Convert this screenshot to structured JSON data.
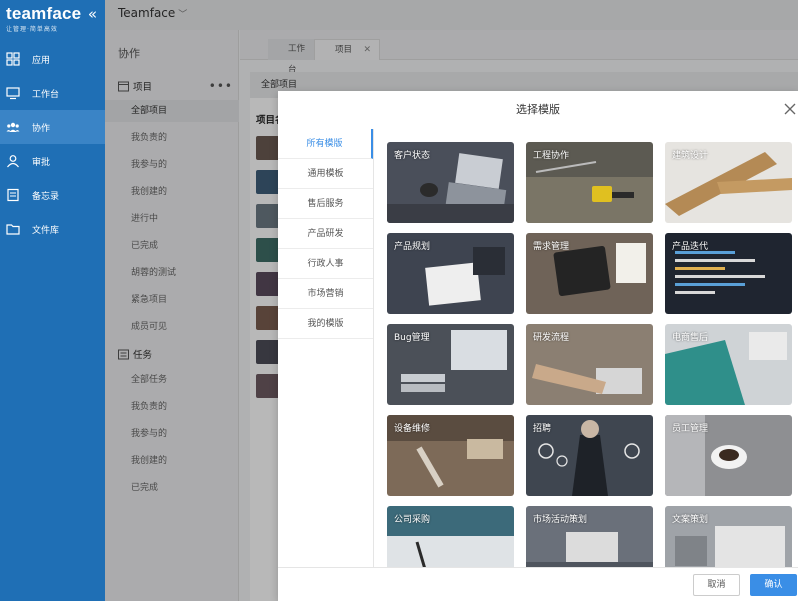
{
  "app": {
    "logo_text": "teamface",
    "logo_sub": "让管理·简单高效",
    "workspace": "Teamface"
  },
  "nav": [
    {
      "label": "应用",
      "icon": "apps-icon"
    },
    {
      "label": "工作台",
      "icon": "monitor-icon"
    },
    {
      "label": "协作",
      "icon": "team-icon",
      "active": true
    },
    {
      "label": "审批",
      "icon": "user-icon"
    },
    {
      "label": "备忘录",
      "icon": "memo-icon"
    },
    {
      "label": "文件库",
      "icon": "folder-icon"
    }
  ],
  "sidebar": {
    "title": "协作",
    "project_section": "项目",
    "project_items": [
      "全部项目",
      "我负责的",
      "我参与的",
      "我创建的",
      "进行中",
      "已完成",
      "胡蓉的测试",
      "紧急项目",
      "成员可见"
    ],
    "task_section": "任务",
    "task_items": [
      "全部任务",
      "我负责的",
      "我参与的",
      "我创建的",
      "已完成"
    ]
  },
  "tabs": [
    "工作台",
    "项目"
  ],
  "content": {
    "header": "全部项目",
    "label": "项目名"
  },
  "modal": {
    "title": "选择模版",
    "categories": [
      "所有模版",
      "通用模板",
      "售后服务",
      "产品研发",
      "行政人事",
      "市场营销",
      "我的模版"
    ],
    "templates": [
      "客户状态",
      "工程协作",
      "建筑设计",
      "产品规划",
      "需求管理",
      "产品迭代",
      "Bug管理",
      "研发流程",
      "电商售后",
      "设备维修",
      "招聘",
      "员工管理",
      "公司采购",
      "市场活动策划",
      "文案策划"
    ],
    "cancel_label": "取消",
    "ok_label": "确认"
  },
  "colors": {
    "nav_bg": "#1f6fb5",
    "accent": "#3a8ee6"
  }
}
